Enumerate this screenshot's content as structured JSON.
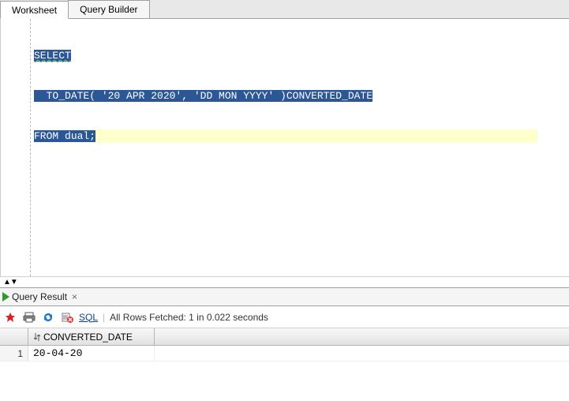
{
  "tabs": {
    "worksheet": "Worksheet",
    "query_builder": "Query Builder"
  },
  "sql": {
    "line1_kw": "SELECT",
    "line2_indent": "  ",
    "line2_a": "TO_DATE( '20 APR 2020', 'DD MON YYYY' )CONVERTED_DATE",
    "line3_kw": "FROM",
    "line3_rest": " dual;"
  },
  "results_tab": {
    "label": "Query Result",
    "close": "×"
  },
  "toolbar": {
    "sql_label": "SQL",
    "separator": "|",
    "status": "All Rows Fetched: 1 in 0.022 seconds"
  },
  "grid": {
    "columns": [
      "CONVERTED_DATE"
    ],
    "rows": [
      {
        "n": "1",
        "cells": [
          "20-04-20"
        ]
      }
    ]
  }
}
